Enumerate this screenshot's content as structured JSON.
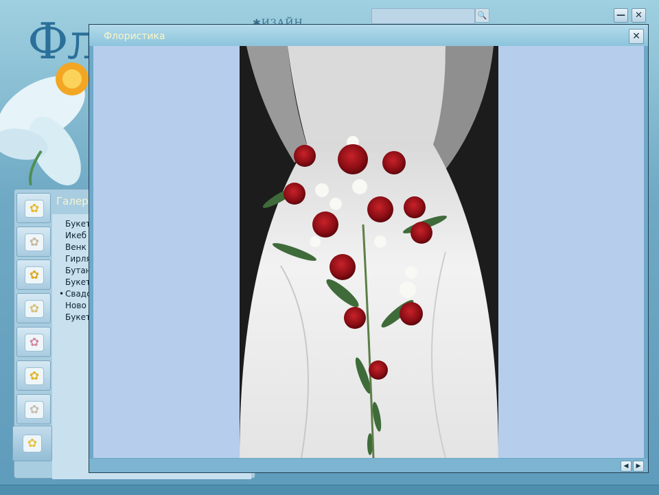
{
  "app": {
    "logo_text": "Фл",
    "design_text": "✱ИЗАЙН",
    "search": {
      "placeholder": ""
    }
  },
  "sidebar": {
    "title": "Галер",
    "items": [
      {
        "label": "Букет",
        "current": false
      },
      {
        "label": "Икеб",
        "current": false
      },
      {
        "label": "Венк",
        "current": false
      },
      {
        "label": "Гирля",
        "current": false
      },
      {
        "label": "Бутан",
        "current": false
      },
      {
        "label": "Букет",
        "current": false
      },
      {
        "label": "Свадс",
        "current": true
      },
      {
        "label": "Ново",
        "current": false
      },
      {
        "label": "Букет",
        "current": false
      }
    ],
    "icon_tabs": [
      "yellow-flower-icon",
      "white-flower-icon",
      "yellow-flower-icon",
      "white-flower-icon",
      "pink-flower-icon",
      "yellow-flower-icon",
      "white-flower-icon",
      "yellow-flower-icon"
    ]
  },
  "popup": {
    "title": "Флористика",
    "close_label": "✕",
    "nav_prev": "◀",
    "nav_next": "▶"
  },
  "window_controls": {
    "minimize": "—",
    "close": "✕"
  },
  "colors": {
    "accent": "#8cc4dc",
    "content_bg": "#b6cdec",
    "title_text": "#fbf6c6"
  }
}
